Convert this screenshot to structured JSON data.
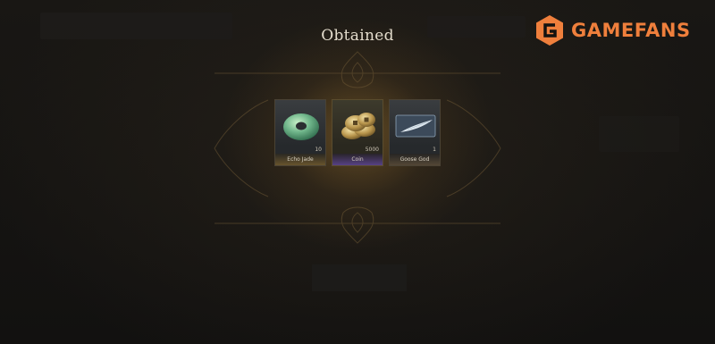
{
  "header": {
    "title": "Obtained"
  },
  "watermark": {
    "brand": "GAMEFANS",
    "color": "#ef7f3c"
  },
  "rewards": [
    {
      "name": "Echo Jade",
      "quantity": "10",
      "icon": "jade-disc-icon",
      "rarity_color": "#8a6a3a"
    },
    {
      "name": "Coin",
      "quantity": "5000",
      "icon": "coins-icon",
      "rarity_color": "#6a55a8"
    },
    {
      "name": "Goose God",
      "quantity": "1",
      "icon": "goose-feather-icon",
      "rarity_color": "#7a6248"
    }
  ],
  "confirm_button": {
    "label": ""
  },
  "colors": {
    "background": "#141210",
    "glow": "#96702d",
    "title_text": "#e4ddcd"
  }
}
